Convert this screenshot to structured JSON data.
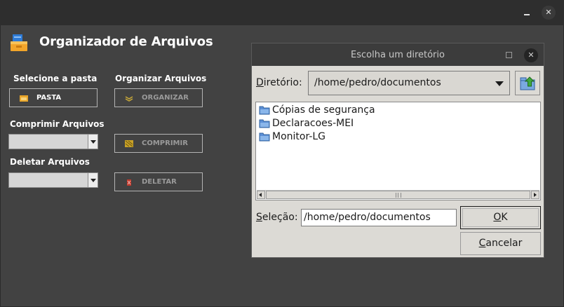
{
  "window": {
    "close_glyph": "✕"
  },
  "app": {
    "title": "Organizador de Arquivos",
    "icon": "file-cabinet-icon",
    "sections": {
      "select_folder": {
        "label": "Selecione a pasta",
        "button": "PASTA"
      },
      "organize": {
        "label": "Organizar Arquivos",
        "button": "ORGANIZAR"
      },
      "compress": {
        "label": "Comprimir Arquivos",
        "button": "COMPRIMIR",
        "combo_value": ""
      },
      "delete": {
        "label": "Deletar Arquivos",
        "button": "DELETAR",
        "combo_value": ""
      }
    }
  },
  "dialog": {
    "title": "Escolha um diretório",
    "close_glyph": "✕",
    "directory_label_first": "D",
    "directory_label_rest": "iretório:",
    "directory_value": "/home/pedro/documentos",
    "folders": [
      "Cópias de segurança",
      "Declaracoes-MEI",
      "Monitor-LG"
    ],
    "selection_label_first": "S",
    "selection_label_rest": "eleção:",
    "selection_value": "/home/pedro/documentos",
    "ok_first": "O",
    "ok_rest": "K",
    "cancel_first": "C",
    "cancel_rest": "ancelar"
  },
  "colors": {
    "app_bg": "#424242",
    "dialog_bg": "#dcdad5",
    "folder_blue": "#5b8fd6"
  }
}
